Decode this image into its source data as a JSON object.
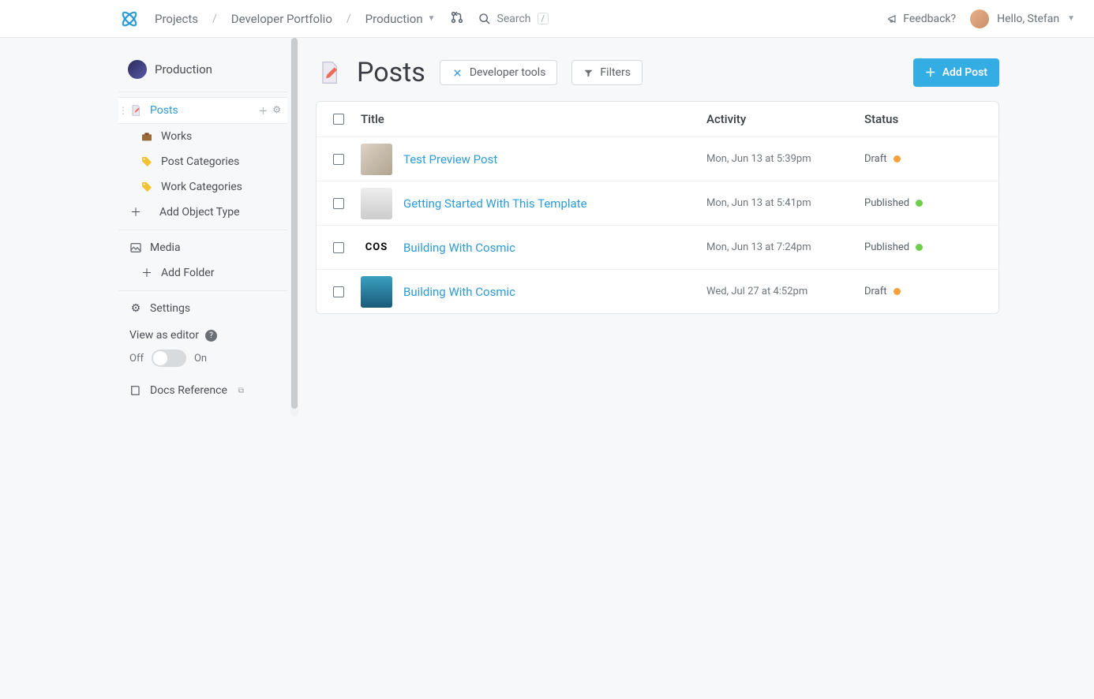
{
  "header": {
    "breadcrumb": {
      "root": "Projects",
      "project": "Developer Portfolio",
      "env": "Production"
    },
    "search_label": "Search",
    "search_key": "/",
    "feedback": "Feedback?",
    "greeting": "Hello, Stefan"
  },
  "sidebar": {
    "bucket": "Production",
    "items": [
      {
        "label": "Posts",
        "active": true
      },
      {
        "label": "Works"
      },
      {
        "label": "Post Categories"
      },
      {
        "label": "Work Categories"
      }
    ],
    "add_object": "Add Object Type",
    "media": "Media",
    "add_folder": "Add Folder",
    "settings": "Settings",
    "view_editor": "View as editor",
    "toggle_off": "Off",
    "toggle_on": "On",
    "docs": "Docs Reference"
  },
  "page": {
    "title": "Posts",
    "dev_tools": "Developer tools",
    "filters": "Filters",
    "add_post": "Add Post"
  },
  "table": {
    "cols": {
      "title": "Title",
      "activity": "Activity",
      "status": "Status"
    },
    "rows": [
      {
        "title": "Test Preview Post",
        "activity": "Mon, Jun 13 at 5:39pm",
        "status": "Draft",
        "dot": "draft",
        "thumb": "t1"
      },
      {
        "title": "Getting Started With This Template",
        "activity": "Mon, Jun 13 at 5:41pm",
        "status": "Published",
        "dot": "pub",
        "thumb": "t2"
      },
      {
        "title": "Building With Cosmic",
        "activity": "Mon, Jun 13 at 7:24pm",
        "status": "Published",
        "dot": "pub",
        "thumb": "t3",
        "thumb_text": "COS"
      },
      {
        "title": "Building With Cosmic",
        "activity": "Wed, Jul 27 at 4:52pm",
        "status": "Draft",
        "dot": "draft",
        "thumb": "t4"
      }
    ]
  }
}
